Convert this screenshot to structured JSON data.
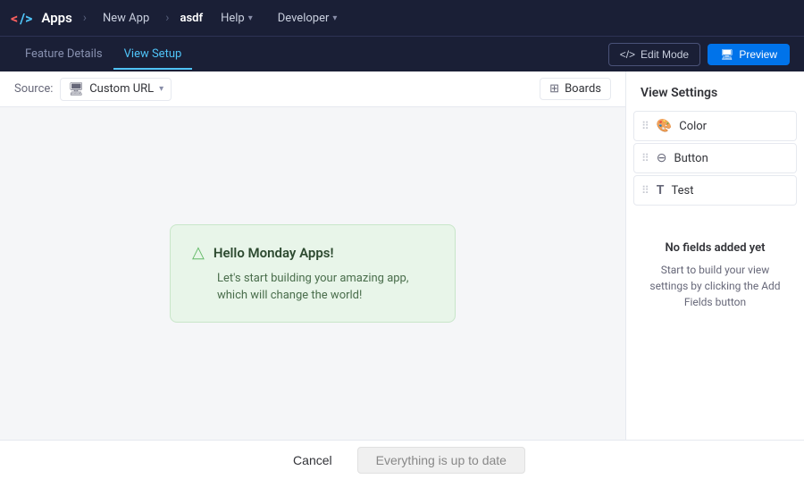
{
  "topnav": {
    "logo_left": "<",
    "logo_right": "/>",
    "brand": "Apps",
    "new_app": "New App",
    "current_page": "asdf",
    "help": "Help",
    "developer": "Developer"
  },
  "subnav": {
    "tabs": [
      {
        "label": "Feature Details",
        "active": false
      },
      {
        "label": "View Setup",
        "active": true
      }
    ],
    "edit_mode_label": "Edit Mode",
    "preview_label": "Preview"
  },
  "toolbar": {
    "source_label": "Source:",
    "source_value": "Custom URL",
    "boards_label": "Boards"
  },
  "hello_card": {
    "title": "Hello Monday Apps!",
    "body": "Let's start building your amazing app, which will change the world!"
  },
  "right_panel": {
    "title": "View Settings",
    "fields": [
      {
        "label": "Color",
        "type_icon": "🎨"
      },
      {
        "label": "Button",
        "type_icon": "⊖"
      },
      {
        "label": "Test",
        "type_icon": "T"
      }
    ],
    "no_fields_title": "No fields added yet",
    "no_fields_desc": "Start to build your view settings by clicking the Add Fields button"
  },
  "bottom_bar": {
    "cancel_label": "Cancel",
    "status_label": "Everything is up to date"
  }
}
